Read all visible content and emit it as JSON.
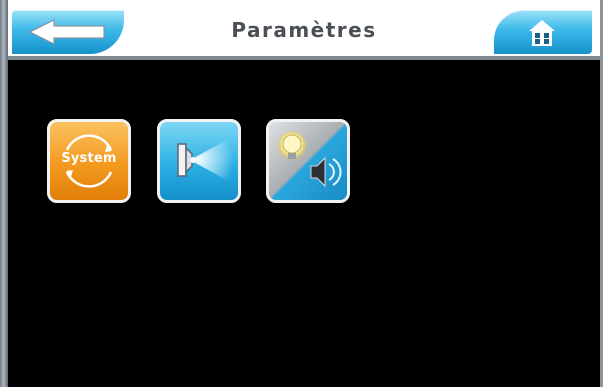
{
  "header": {
    "title": "Paramètres",
    "back_icon": "back-arrow-icon",
    "home_icon": "home-icon"
  },
  "tiles": [
    {
      "id": "system",
      "label": "System",
      "icon": "system-icon",
      "color": "#f39a1f"
    },
    {
      "id": "projector",
      "icon": "projector-icon",
      "color": "#2bb0e4"
    },
    {
      "id": "light-sound",
      "icon": "light-sound-icon",
      "color": "#2ba6dc"
    }
  ],
  "colors": {
    "background": "#000000",
    "header_bg": "#ffffff",
    "title_text": "#4a4f55",
    "button_blue": "#3cb8ea"
  }
}
